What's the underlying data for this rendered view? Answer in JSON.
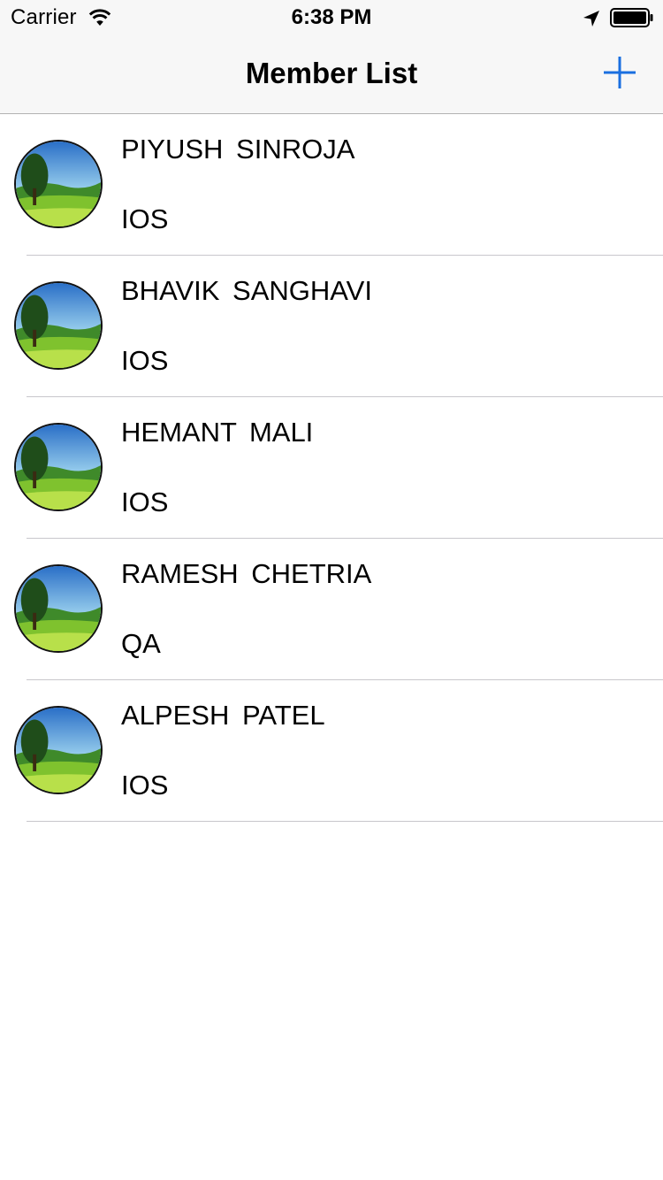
{
  "status_bar": {
    "carrier": "Carrier",
    "time": "6:38 PM"
  },
  "nav": {
    "title": "Member List",
    "add_icon": "plus-icon"
  },
  "colors": {
    "accent": "#1a6fe0",
    "bar_background": "#f7f7f7",
    "separator": "#c8c7cc"
  },
  "members": [
    {
      "name": "PIYUSH  SINROJA",
      "role": "IOS"
    },
    {
      "name": "BHAVIK  SANGHAVI",
      "role": "IOS"
    },
    {
      "name": "HEMANT  MALI",
      "role": "IOS"
    },
    {
      "name": "RAMESH  CHETRIA",
      "role": "QA"
    },
    {
      "name": "ALPESH  PATEL",
      "role": "IOS"
    }
  ]
}
